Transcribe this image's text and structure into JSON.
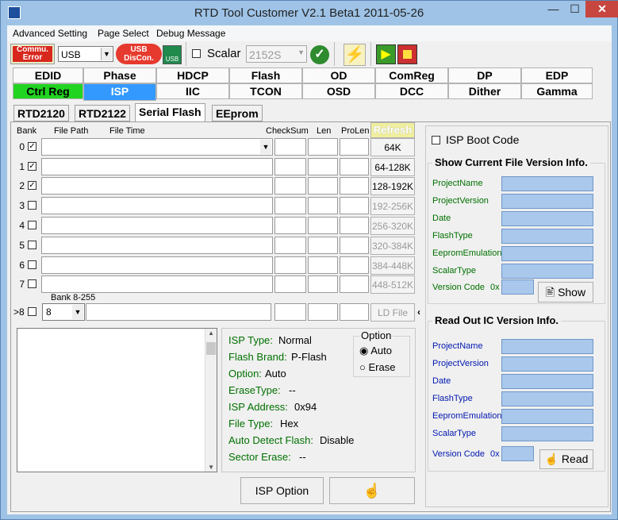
{
  "window": {
    "title": "RTD Tool Customer V2.1 Beta1    2011-05-26",
    "min": "—",
    "max": "☐",
    "close": "✕"
  },
  "menu": [
    "Advanced Setting",
    "Page Select",
    "Debug Message"
  ],
  "toolbar": {
    "commu_error": "Commu. Error",
    "port": "USB",
    "usb_discon": "USB DisCon.",
    "scalar_label": "Scalar",
    "scalar_value": "2152S"
  },
  "tabs_row1": [
    "EDID",
    "Phase",
    "HDCP",
    "Flash",
    "OD",
    "ComReg",
    "DP",
    "EDP"
  ],
  "tabs_row2": [
    "Ctrl Reg",
    "ISP",
    "IIC",
    "TCON",
    "OSD",
    "DCC",
    "Dither",
    "Gamma"
  ],
  "subtabs": [
    "RTD2120",
    "RTD2122",
    "Serial Flash",
    "EEprom"
  ],
  "table": {
    "headers": [
      "Bank",
      "File Path",
      "File Time",
      "CheckSum",
      "Len",
      "ProLen"
    ],
    "refresh": "Refresh",
    "rows": [
      {
        "bank": "0",
        "checked": true
      },
      {
        "bank": "1",
        "checked": true
      },
      {
        "bank": "2",
        "checked": true
      },
      {
        "bank": "3",
        "checked": false
      },
      {
        "bank": "4",
        "checked": false
      },
      {
        "bank": "5",
        "checked": false
      },
      {
        "bank": "6",
        "checked": false
      },
      {
        "bank": "7",
        "checked": false
      }
    ],
    "range_buttons": [
      "64K",
      "64-128K",
      "128-192K",
      "192-256K",
      "256-320K",
      "320-384K",
      "384-448K",
      "448-512K"
    ],
    "bank8_label": "Bank 8-255",
    "bank8_prefix": ">8",
    "bank8_value": "8",
    "ld_file": "LD File"
  },
  "isp_info": [
    {
      "label": "ISP Type:",
      "value": "Normal"
    },
    {
      "label": "Flash Brand:",
      "value": "P-Flash"
    },
    {
      "label": "Option:",
      "value": "Auto"
    },
    {
      "label": "EraseType:",
      "value": "--"
    },
    {
      "label": "ISP Address:",
      "value": "0x94"
    },
    {
      "label": "File Type:",
      "value": "Hex"
    },
    {
      "label": "Auto Detect Flash:",
      "value": "Disable"
    },
    {
      "label": "Sector Erase:",
      "value": "--"
    }
  ],
  "option_group": {
    "title": "Option",
    "auto": "Auto",
    "erase": "Erase",
    "selected": "Auto"
  },
  "isp_option_button": "ISP Option",
  "isp_boot_code": "ISP Boot Code",
  "current_file": {
    "title": "Show Current File Version Info.",
    "fields": [
      "ProjectName",
      "ProjectVersion",
      "Date",
      "FlashType",
      "EepromEmulation",
      "ScalarType"
    ],
    "version_code": "Version Code",
    "prefix": "0x",
    "button": "Show"
  },
  "read_out": {
    "title": "Read Out IC Version Info.",
    "fields": [
      "ProjectName",
      "ProjectVersion",
      "Date",
      "FlashType",
      "EepromEmulation",
      "ScalarType"
    ],
    "version_code": "Version Code",
    "prefix": "0x",
    "button": "Read"
  }
}
